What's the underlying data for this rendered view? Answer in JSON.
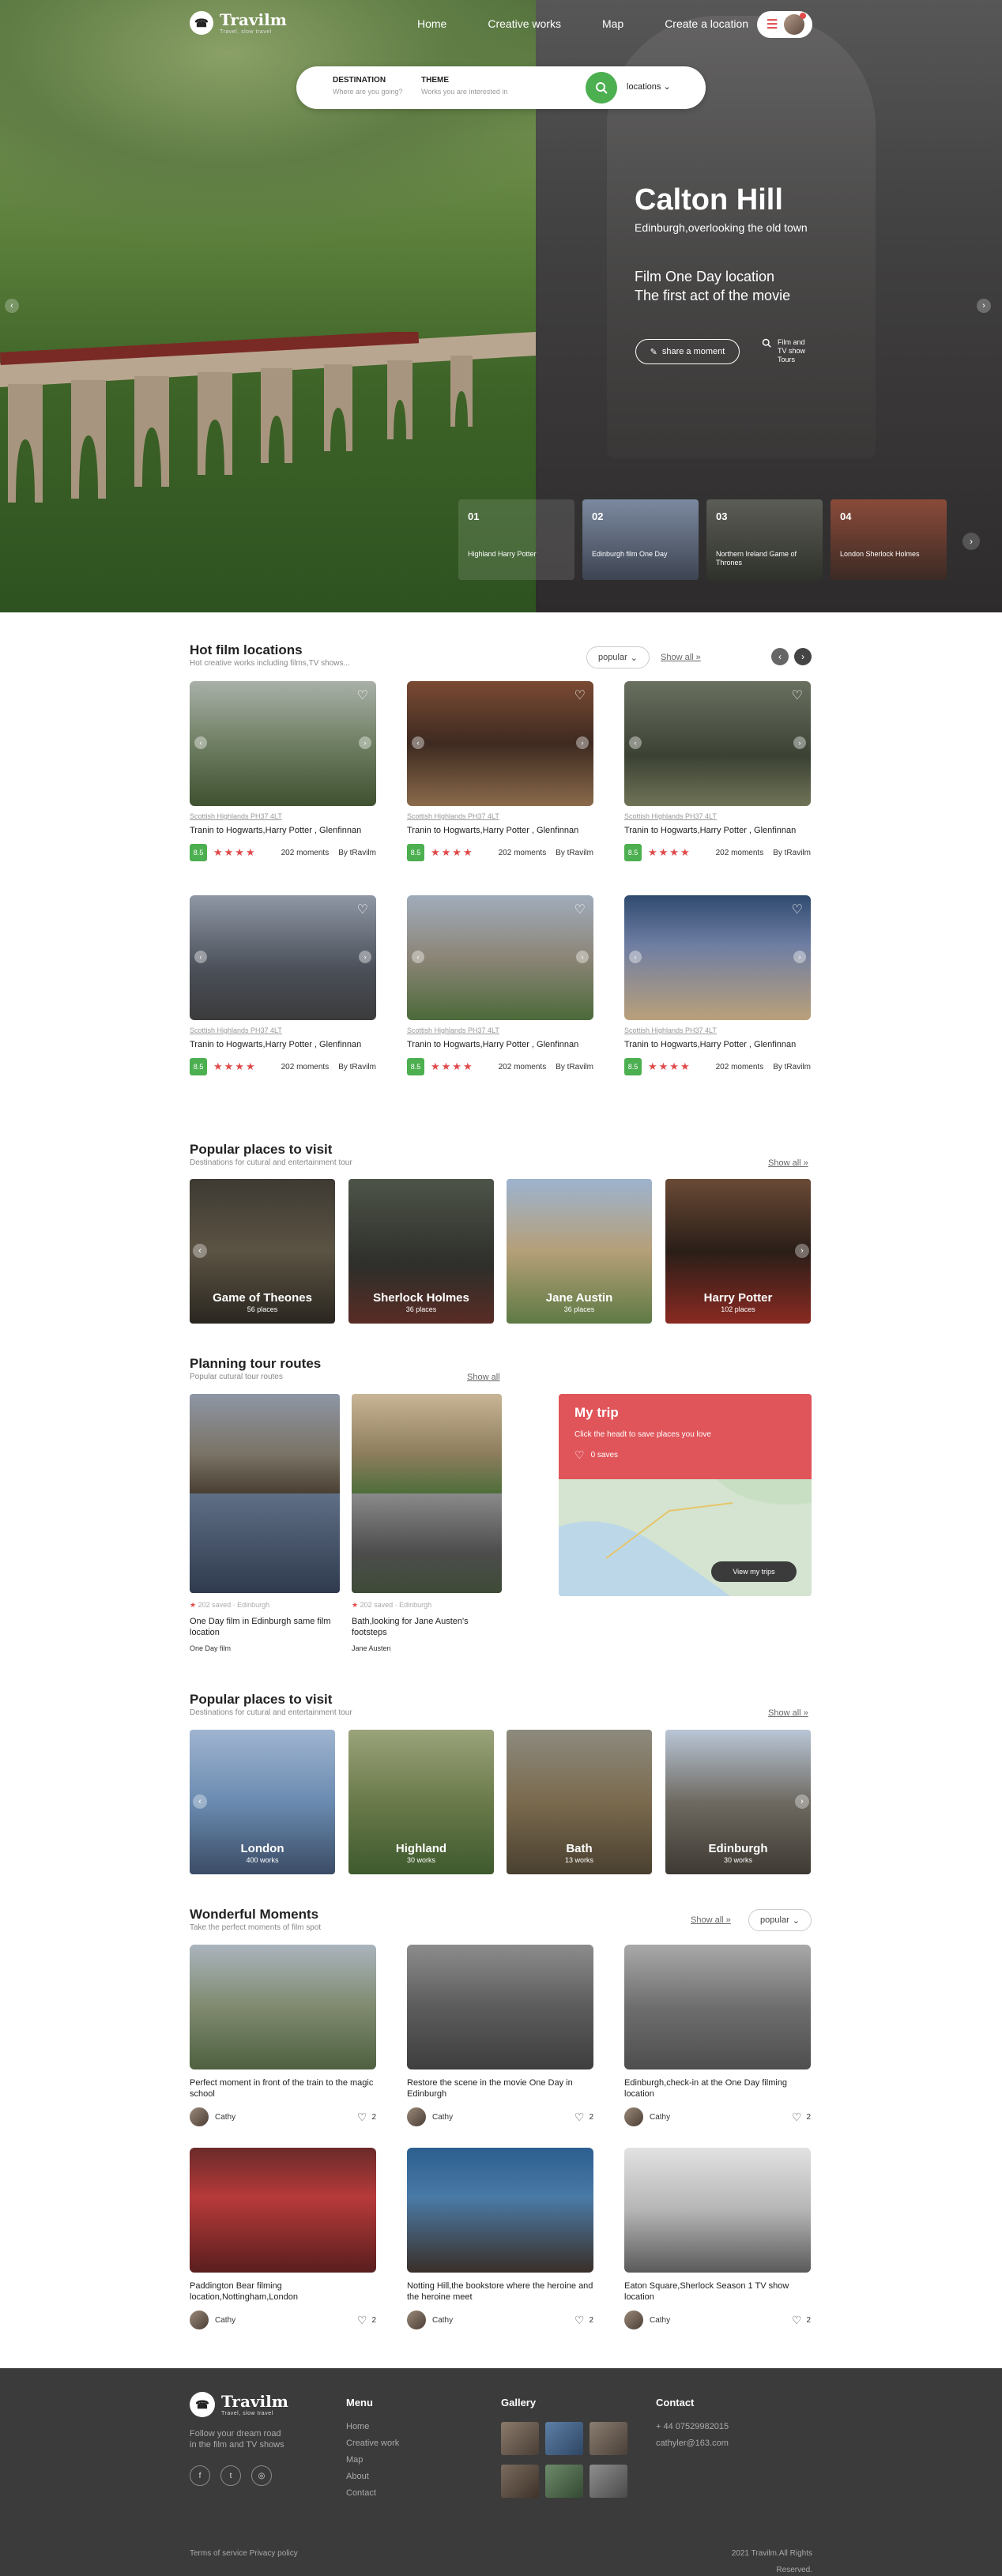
{
  "nav": {
    "brand": "Travilm",
    "tagline": "Travel, slow travel",
    "links": [
      "Home",
      "Creative works",
      "Map",
      "Create a location"
    ]
  },
  "search": {
    "destination_label": "DESTINATION",
    "destination_placeholder": "Where are you going?",
    "theme_label": "THEME",
    "theme_placeholder": "Works you are interested in",
    "scope": "locations"
  },
  "hero": {
    "title": "Calton Hill",
    "subtitle": "Edinburgh,overlooking the old town",
    "tag_line1": "Film One Day location",
    "tag_line2": "The first act of the movie",
    "share_label": "share a moment",
    "tours_label": "Film and TV show Tours",
    "slides": [
      {
        "num": "01",
        "title": "Highland Harry Potter"
      },
      {
        "num": "02",
        "title": "Edinburgh film One Day"
      },
      {
        "num": "03",
        "title": "Northern Ireland Game of Thrones"
      },
      {
        "num": "04",
        "title": "London Sherlock Holmes"
      }
    ]
  },
  "hot": {
    "title": "Hot film locations",
    "subtitle": "Hot creative works including films,TV shows...",
    "sort": "popular",
    "show_all": "Show all »",
    "cards": [
      {
        "loc": "Scottish Highlands PH37 4LT",
        "title": "Tranin to Hogwarts,Harry Potter , Glenfinnan",
        "score": "8.5",
        "moments": "202 moments",
        "by": "By tRavilm"
      },
      {
        "loc": "Scottish Highlands PH37 4LT",
        "title": "Tranin to Hogwarts,Harry Potter , Glenfinnan",
        "score": "8.5",
        "moments": "202 moments",
        "by": "By tRavilm"
      },
      {
        "loc": "Scottish Highlands PH37 4LT",
        "title": "Tranin to Hogwarts,Harry Potter , Glenfinnan",
        "score": "8.5",
        "moments": "202 moments",
        "by": "By tRavilm"
      },
      {
        "loc": "Scottish Highlands PH37 4LT",
        "title": "Tranin to Hogwarts,Harry Potter , Glenfinnan",
        "score": "8.5",
        "moments": "202 moments",
        "by": "By tRavilm"
      },
      {
        "loc": "Scottish Highlands PH37 4LT",
        "title": "Tranin to Hogwarts,Harry Potter , Glenfinnan",
        "score": "8.5",
        "moments": "202 moments",
        "by": "By tRavilm"
      },
      {
        "loc": "Scottish Highlands PH37 4LT",
        "title": "Tranin to Hogwarts,Harry Potter , Glenfinnan",
        "score": "8.5",
        "moments": "202 moments",
        "by": "By tRavilm"
      }
    ]
  },
  "popular1": {
    "title": "Popular places to visit",
    "subtitle": "Destinations for cutural and entertainment tour",
    "show_all": "Show all »",
    "places": [
      {
        "name": "Game of Theones",
        "count": "56 places"
      },
      {
        "name": "Sherlock Holmes",
        "count": "36 places"
      },
      {
        "name": "Jane Austin",
        "count": "36 places"
      },
      {
        "name": "Harry Potter",
        "count": "102 places"
      }
    ]
  },
  "routes": {
    "title": "Planning tour routes",
    "subtitle": "Popular cutural tour routes",
    "show_all": "Show all",
    "items": [
      {
        "meta": "202 saved · Edinburgh",
        "title": "One Day film in Edinburgh same film location",
        "tag": "One Day film"
      },
      {
        "meta": "202 saved · Edinburgh",
        "title": "Bath,looking for Jane Austen's footsteps",
        "tag": "Jane Austen"
      }
    ],
    "trip": {
      "title": "My trip",
      "text": "Click the headt to save places you love",
      "saves": "0 saves",
      "button": "View my trips"
    }
  },
  "popular2": {
    "title": "Popular places to visit",
    "subtitle": "Destinations for cutural and entertainment tour",
    "show_all": "Show all »",
    "places": [
      {
        "name": "London",
        "count": "400 works"
      },
      {
        "name": "Highland",
        "count": "30 works"
      },
      {
        "name": "Bath",
        "count": "13 works"
      },
      {
        "name": "Edinburgh",
        "count": "30 works"
      }
    ]
  },
  "moments": {
    "title": "Wonderful Moments",
    "subtitle": "Take the perfect moments of film spot",
    "show_all": "Show all »",
    "sort": "popular",
    "items": [
      {
        "title": "Perfect moment in front of the train to the magic school",
        "user": "Cathy",
        "likes": "2"
      },
      {
        "title": "Restore the scene in the movie One Day in Edinburgh",
        "user": "Cathy",
        "likes": "2"
      },
      {
        "title": "Edinburgh,check-in at the One Day filming location",
        "user": "Cathy",
        "likes": "2"
      },
      {
        "title": "Paddington Bear filming location,Nottingham,London",
        "user": "Cathy",
        "likes": "2"
      },
      {
        "title": "Notting Hill,the bookstore where the heroine and the heroine meet",
        "user": "Cathy",
        "likes": "2"
      },
      {
        "title": "Eaton Square,Sherlock Season 1 TV show location",
        "user": "Cathy",
        "likes": "2"
      }
    ]
  },
  "footer": {
    "brand": "Travilm",
    "tagline": "Travel, slow travel",
    "blurb1": "Follow your dream road",
    "blurb2": "in the film and TV shows",
    "menu_title": "Menu",
    "menu": [
      "Home",
      "Creative work",
      "Map",
      "About",
      "Contact"
    ],
    "gallery_title": "Gallery",
    "contact_title": "Contact",
    "phone": "+ 44 07529982015",
    "email": "cathyler@163.com",
    "legal": "Terms of service Privacy policy",
    "copyright": "2021 Travilm.All Rights Reserved."
  },
  "colors": {
    "accent": "#e04a4a",
    "green": "#4caf50",
    "footer_bg": "#3b3b3b"
  }
}
